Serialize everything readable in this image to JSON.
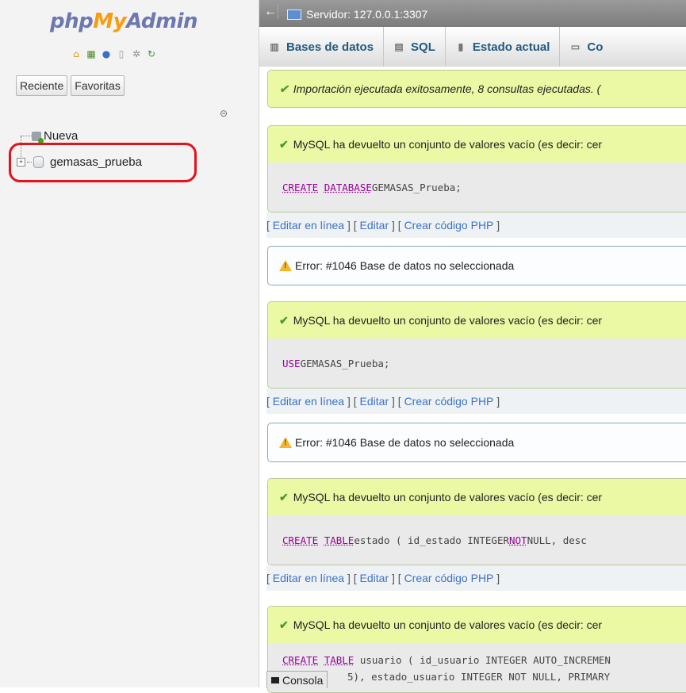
{
  "nav": {
    "logo": {
      "php": "php",
      "my": "My",
      "admin": "Admin"
    },
    "icons": [
      "home-icon",
      "logout-icon",
      "help-icon",
      "docs-icon",
      "settings-icon",
      "reload-icon"
    ],
    "recent_label": "Reciente",
    "favorites_label": "Favoritas",
    "tree": {
      "new_label": "Nueva",
      "databases": [
        "gemasas_prueba"
      ]
    },
    "accent_color": "#e3121b"
  },
  "topbar": {
    "server_label": "Servidor: 127.0.0.1:3307"
  },
  "tabs": [
    {
      "label": "Bases de datos",
      "icon": "database-icon"
    },
    {
      "label": "SQL",
      "icon": "sql-icon"
    },
    {
      "label": "Estado actual",
      "icon": "status-icon"
    },
    {
      "label": "Co",
      "icon": "accounts-icon"
    }
  ],
  "content": {
    "import_message": "Importación ejecutada exitosamente, 8 consultas ejecutadas. (",
    "empty_result": "MySQL ha devuelto un conjunto de valores vacío (es decir: cer",
    "error_message": "Error: #1046 Base de datos no seleccionada",
    "links": {
      "inline_edit": "Editar en línea",
      "edit": "Editar",
      "php_code": "Crear código PHP"
    },
    "queries": {
      "q1": {
        "k1": "CREATE",
        "k2": "DATABASE",
        "rest": " GEMASAS_Prueba;"
      },
      "q2": {
        "k1": "USE",
        "rest": " GEMASAS_Prueba;"
      },
      "q3": {
        "k1": "CREATE",
        "k2": "TABLE",
        "rest1": " estado ( id_estado INTEGER ",
        "k3": "NOT",
        "rest2": " NULL, desc"
      },
      "q4": {
        "k1": "CREATE",
        "k2": "TABLE",
        "rest": " usuario ( id_usuario INTEGER AUTO_INCREMEN"
      },
      "q4_line2": "5), estado_usuario INTEGER NOT NULL, PRIMARY"
    }
  },
  "console_label": "Consola"
}
